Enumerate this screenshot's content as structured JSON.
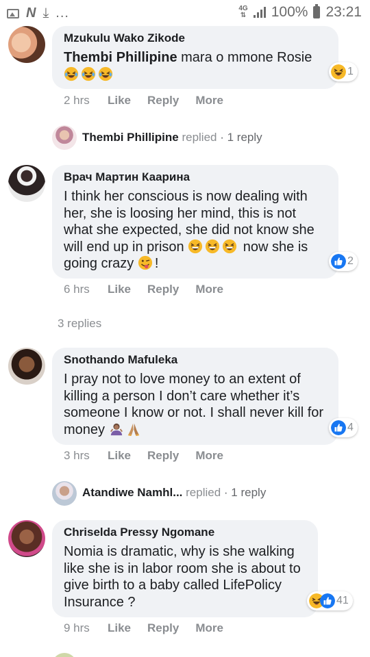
{
  "status_bar": {
    "network": "4G",
    "battery": "100%",
    "time": "23:21",
    "dots": "..."
  },
  "comments": [
    {
      "author": "Mzukulu Wako Zikode",
      "tagged": "Thembi Phillipine",
      "text": " mara o mmone Rosie",
      "reaction_count": "1",
      "time": "2 hrs",
      "like": "Like",
      "reply": "Reply",
      "more": "More"
    },
    {
      "author": "Врач Мартин Каарина",
      "text_part1": "I think her conscious is now dealing with her, she is loosing her mind, this is not what she expected, she did not know she will end up in prison ",
      "text_part2": " now she is going crazy ",
      "text_part3": "!",
      "reaction_count": "2",
      "time": "6 hrs",
      "like": "Like",
      "reply": "Reply",
      "more": "More"
    },
    {
      "author": "Snothando Mafuleka",
      "text": "I pray not to love money to an extent of killing a person I don’t care whether it’s someone I know or not. I shall never kill for money ",
      "reaction_count": "4",
      "time": "3 hrs",
      "like": "Like",
      "reply": "Reply",
      "more": "More"
    },
    {
      "author": "Chriselda Pressy Ngomane",
      "text": "Nomia is dramatic, why is she walking like she is in labor room she is about to give birth to a baby called LifePolicy Insurance ?",
      "reaction_count": "41",
      "time": "9 hrs",
      "like": "Like",
      "reply": "Reply",
      "more": "More"
    }
  ],
  "replies": [
    {
      "name": "Thembi Phillipine",
      "action": " replied",
      "count": " · 1 reply"
    },
    {
      "name": "Atandiwe Namhl...",
      "action": " replied",
      "count": " · 1 reply"
    }
  ],
  "more_replies": "3 replies",
  "colors": {
    "bubble": "#f0f2f5",
    "like_blue": "#1877f2",
    "haha_yellow": "#f7b928",
    "muted": "#8a8d91"
  },
  "icons": [
    "image-icon",
    "n-icon",
    "download-icon",
    "signal-icon",
    "battery-icon",
    "laughing-emoji-icon",
    "haha-reaction-icon",
    "like-reaction-icon",
    "grin-emoji-icon",
    "wink-tongue-emoji-icon",
    "woman-shrug-emoji-icon",
    "pray-emoji-icon"
  ]
}
